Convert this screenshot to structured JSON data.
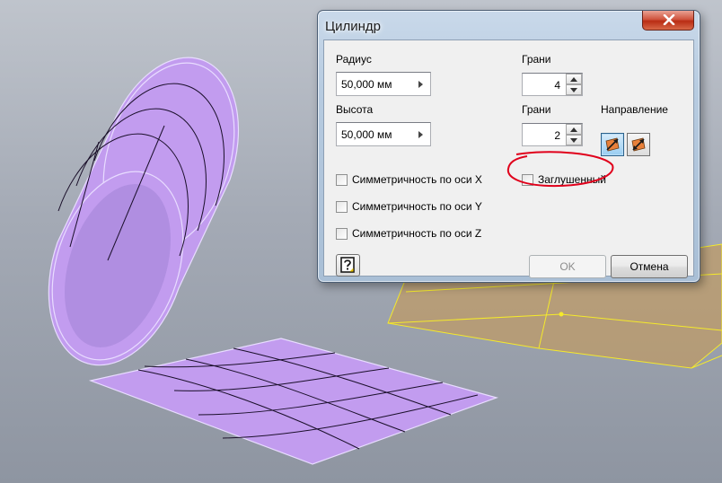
{
  "dialog": {
    "title": "Цилиндр",
    "radius": {
      "label": "Радиус",
      "value": "50,000 мм"
    },
    "height": {
      "label": "Высота",
      "value": "50,000 мм"
    },
    "faces1": {
      "label": "Грани",
      "value": "4"
    },
    "faces2": {
      "label": "Грани",
      "value": "2"
    },
    "direction": {
      "label": "Направление"
    },
    "checkboxes": {
      "sym_x": "Симметричность по оси X",
      "sym_y": "Симметричность по оси Y",
      "sym_z": "Симметричность по оси Z",
      "capped": "Заглушенный"
    },
    "buttons": {
      "ok": "OK",
      "cancel": "Отмена"
    }
  },
  "colors": {
    "surface_fill": "#c29cef",
    "surface_edge": "#e8dcff",
    "grid_line": "#1a0f2a",
    "plane_fill": "#c39a5c",
    "plane_edge": "#f5ea2a",
    "annotation": "#e0001b"
  }
}
